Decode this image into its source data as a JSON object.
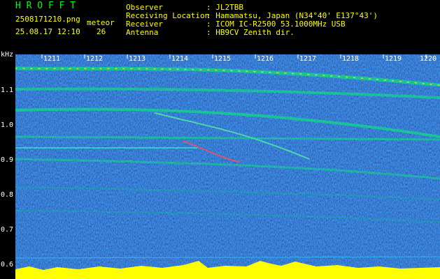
{
  "header": {
    "app_title": "H R O F F T",
    "filename": "2508171210.png",
    "meteor_label": "meteor",
    "datetime": "25.08.17 12:10",
    "meteor_count": "26",
    "fields": [
      {
        "label": "Observer",
        "value": ": JL2TBB"
      },
      {
        "label": "Receiving Location",
        "value": ": Hamamatsu, Japan (N34°40' E137°43')"
      },
      {
        "label": "Receiver",
        "value": ": ICOM IC-R2500 53.1000MHz USB"
      },
      {
        "label": "Antenna",
        "value": ": HB9CV Zenith dir."
      }
    ]
  },
  "axis": {
    "y_unit": "kHz",
    "y_ticks": [
      "1.1",
      "1.0",
      "0.9",
      "0.8",
      "0.7",
      "0.6"
    ],
    "x_ticks": [
      "1211",
      "1212",
      "1213",
      "1214",
      "1215",
      "1216",
      "1217",
      "1218",
      "1219",
      "1220"
    ]
  },
  "colors": {
    "background": "#000000",
    "spectrogram_base": "#0a1a8c",
    "signal": "#00ff66",
    "strong": "#ff3030",
    "level": "#ffff00"
  }
}
